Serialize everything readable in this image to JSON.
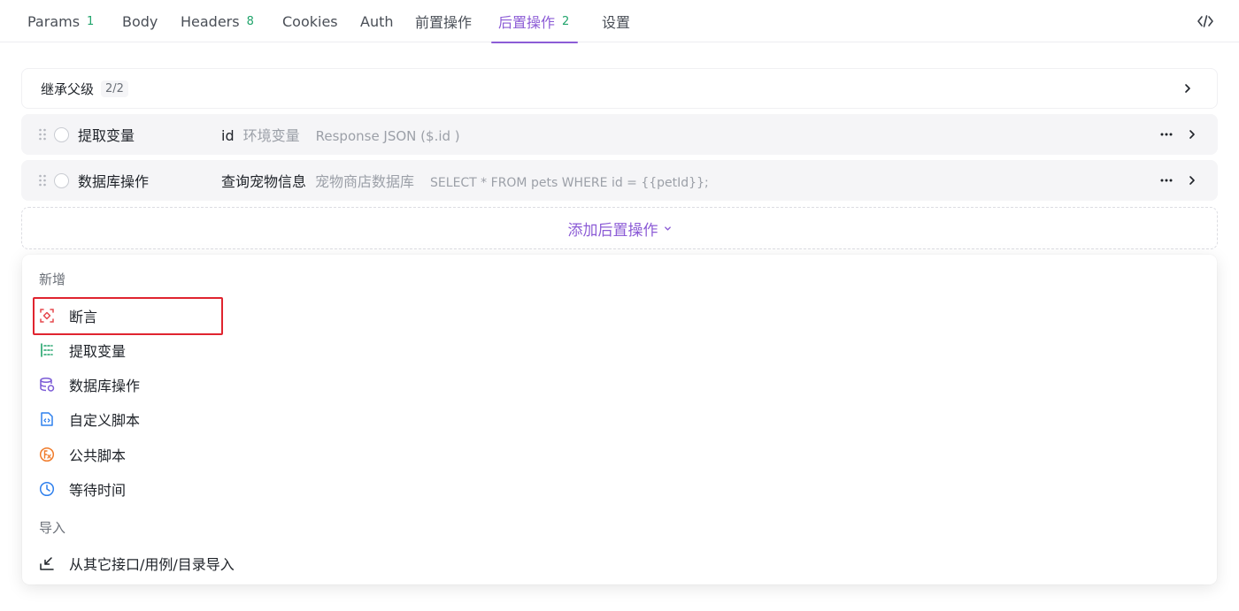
{
  "tabs": [
    {
      "label": "Params",
      "count": "1"
    },
    {
      "label": "Body",
      "count": ""
    },
    {
      "label": "Headers",
      "count": "8"
    },
    {
      "label": "Cookies",
      "count": ""
    },
    {
      "label": "Auth",
      "count": ""
    },
    {
      "label": "前置操作",
      "count": ""
    },
    {
      "label": "后置操作",
      "count": "2"
    },
    {
      "label": "设置",
      "count": ""
    }
  ],
  "active_tab": "后置操作",
  "inherit": {
    "label": "继承父级",
    "count": "2/2"
  },
  "operations": [
    {
      "type": "提取变量",
      "name": "id",
      "meta": "环境变量",
      "detail": "Response JSON ($.id )"
    },
    {
      "type": "数据库操作",
      "name": "查询宠物信息",
      "meta": "宠物商店数据库",
      "detail": "SELECT * FROM pets WHERE id = {{petId}};"
    }
  ],
  "add_button": {
    "label": "添加后置操作"
  },
  "menu": {
    "group_new": "新增",
    "items": [
      {
        "label": "断言",
        "icon": "assertion-icon"
      },
      {
        "label": "提取变量",
        "icon": "extract-variable-icon"
      },
      {
        "label": "数据库操作",
        "icon": "database-icon"
      },
      {
        "label": "自定义脚本",
        "icon": "script-file-icon"
      },
      {
        "label": "公共脚本",
        "icon": "function-icon"
      },
      {
        "label": "等待时间",
        "icon": "clock-icon"
      }
    ],
    "group_import": "导入",
    "import_item": {
      "label": "从其它接口/用例/目录导入",
      "icon": "import-icon"
    }
  },
  "colors": {
    "accent": "#8c5cd6",
    "count": "#20a46b",
    "highlight": "#e0242f",
    "assertion": "#e5484d",
    "extract": "#20a46b",
    "database": "#7c5cd6",
    "script": "#2f80ed",
    "function": "#f07b2a",
    "clock": "#2f80ed"
  }
}
